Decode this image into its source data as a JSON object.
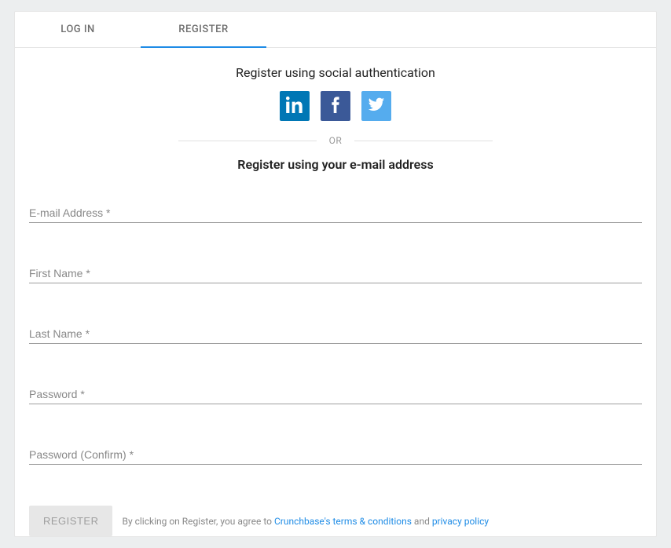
{
  "tabs": {
    "login": "LOG IN",
    "register": "REGISTER"
  },
  "social": {
    "heading": "Register using social authentication"
  },
  "divider": {
    "text": "OR"
  },
  "email": {
    "heading": "Register using your e-mail address"
  },
  "fields": {
    "email_placeholder": "E-mail Address *",
    "first_name_placeholder": "First Name *",
    "last_name_placeholder": "Last Name *",
    "password_placeholder": "Password *",
    "password_confirm_placeholder": "Password (Confirm) *"
  },
  "footer": {
    "button": "REGISTER",
    "disclaimer_prefix": "By clicking on Register, you agree to ",
    "terms_link": "Crunchbase's terms & conditions",
    "disclaimer_mid": " and ",
    "privacy_link": "privacy policy"
  }
}
